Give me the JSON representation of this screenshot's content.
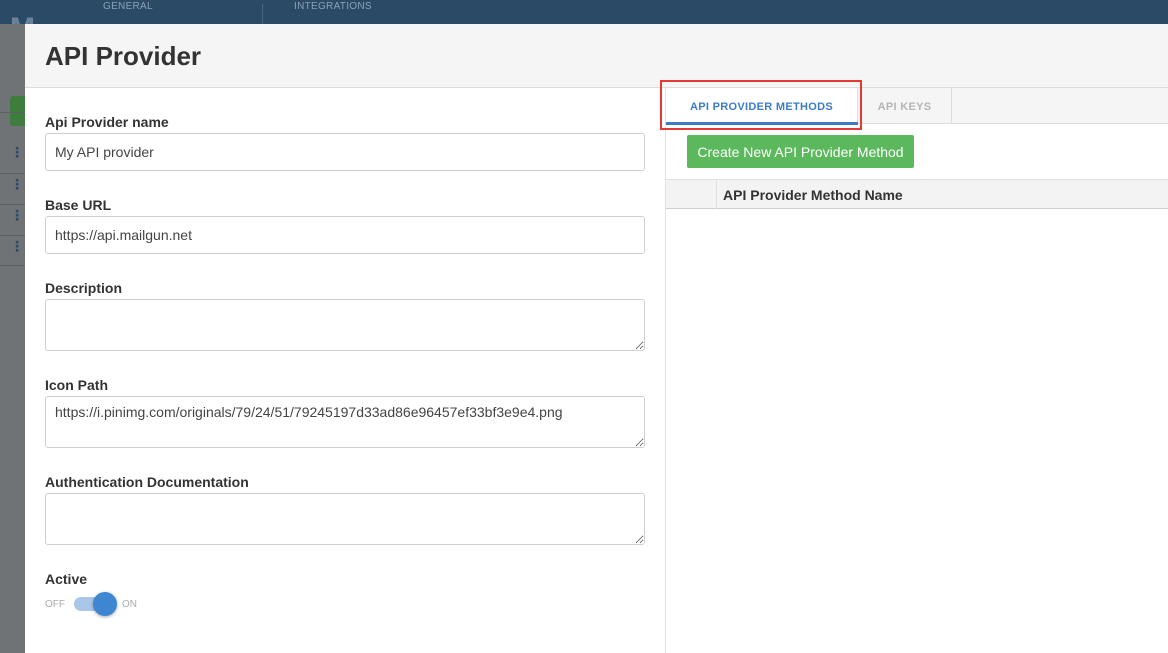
{
  "background": {
    "nav": {
      "general": "GENERAL",
      "integrations": "INTEGRATIONS"
    },
    "logo": "M"
  },
  "modal": {
    "title": "API Provider",
    "form": {
      "name": {
        "label": "Api Provider name",
        "value": "My API provider"
      },
      "base_url": {
        "label": "Base URL",
        "value": "https://api.mailgun.net"
      },
      "description": {
        "label": "Description",
        "value": ""
      },
      "icon_path": {
        "label": "Icon Path",
        "value": "https://i.pinimg.com/originals/79/24/51/79245197d33ad86e96457ef33bf3e9e4.png"
      },
      "auth_doc": {
        "label": "Authentication Documentation",
        "value": ""
      },
      "active": {
        "label": "Active",
        "off": "OFF",
        "on": "ON",
        "state": true
      }
    },
    "tabs": [
      {
        "label": "API PROVIDER METHODS",
        "active": true
      },
      {
        "label": "API KEYS",
        "active": false
      }
    ],
    "create_button": "Create New API Provider Method",
    "table": {
      "columns": [
        "",
        "API Provider Method Name"
      ],
      "rows": []
    }
  },
  "colors": {
    "accent": "#3b7cc9",
    "primary_green": "#5cb85c",
    "highlight_red": "#e53935",
    "header_bar": "#2b4a66"
  }
}
